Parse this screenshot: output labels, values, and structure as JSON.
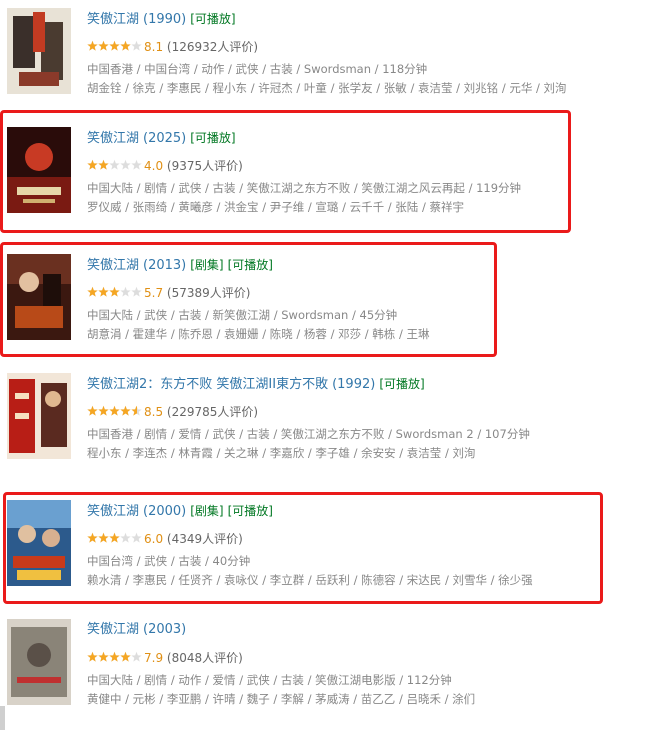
{
  "colors": {
    "link": "#3377aa",
    "tag": "#007722",
    "score": "#e09015",
    "meta": "#888888",
    "highlight": "#ea1a1a",
    "star_on": "#f5a623",
    "star_off": "#dddddd"
  },
  "results": [
    {
      "title": "笑傲江湖",
      "year": "(1990)",
      "tags": [
        "[可播放]"
      ],
      "rating": 4,
      "score": "8.1",
      "votes": "(126932人评价)",
      "meta1": "中国香港 / 中国台湾 / 动作 / 武侠 / 古装 / Swordsman / 118分钟",
      "meta2": "胡金铨 / 徐克 / 李惠民 / 程小东 / 许冠杰 / 叶童 / 张学友 / 张敏 / 袁洁莹 / 刘兆铭 / 元华 / 刘洵"
    },
    {
      "title": "笑傲江湖",
      "year": "(2025)",
      "tags": [
        "[可播放]"
      ],
      "rating": 2,
      "score": "4.0",
      "votes": "(9375人评价)",
      "meta1": "中国大陆 / 剧情 / 武侠 / 古装 / 笑傲江湖之东方不败 / 笑傲江湖之风云再起 / 119分钟",
      "meta2": "罗仪威 / 张雨绮 / 黄曦彦 / 洪金宝 / 尹子维 / 宣璐 / 云千千 / 张陆 / 蔡祥宇"
    },
    {
      "title": "笑傲江湖",
      "year": "(2013)",
      "tags": [
        "[剧集]",
        "[可播放]"
      ],
      "rating": 3,
      "score": "5.7",
      "votes": "(57389人评价)",
      "meta1": "中国大陆 / 武侠 / 古装 / 新笑傲江湖 / Swordsman / 45分钟",
      "meta2": "胡意涓 / 霍建华 / 陈乔恩 / 袁姗姗 / 陈晓 / 杨蓉 / 邓莎 / 韩栋 / 王琳"
    },
    {
      "title": "笑傲江湖2：东方不败 笑傲江湖II東方不敗",
      "year": "(1992)",
      "tags": [
        "[可播放]"
      ],
      "rating": 4.5,
      "score": "8.5",
      "votes": "(229785人评价)",
      "meta1": "中国香港 / 剧情 / 爱情 / 武侠 / 古装 / 笑傲江湖之东方不败 / Swordsman 2 / 107分钟",
      "meta2": "程小东 / 李连杰 / 林青霞 / 关之琳 / 李嘉欣 / 李子雄 / 余安安 / 袁洁莹 / 刘洵"
    },
    {
      "title": "笑傲江湖",
      "year": "(2000)",
      "tags": [
        "[剧集]",
        "[可播放]"
      ],
      "rating": 3,
      "score": "6.0",
      "votes": "(4349人评价)",
      "meta1": "中国台湾 / 武侠 / 古装 / 40分钟",
      "meta2": "赖水清 / 李惠民 / 任贤齐 / 袁咏仪 / 李立群 / 岳跃利 / 陈德容 / 宋达民 / 刘雪华 / 徐少强"
    },
    {
      "title": "笑傲江湖",
      "year": "(2003)",
      "tags": [],
      "rating": 4,
      "score": "7.9",
      "votes": "(8048人评价)",
      "meta1": "中国大陆 / 剧情 / 动作 / 爱情 / 武侠 / 古装 / 笑傲江湖电影版 / 112分钟",
      "meta2": "黄健中 / 元彬 / 李亚鹏 / 许晴 / 魏子 / 李解 / 茅威涛 / 苗乙乙 / 吕晓禾 / 涂们"
    }
  ]
}
